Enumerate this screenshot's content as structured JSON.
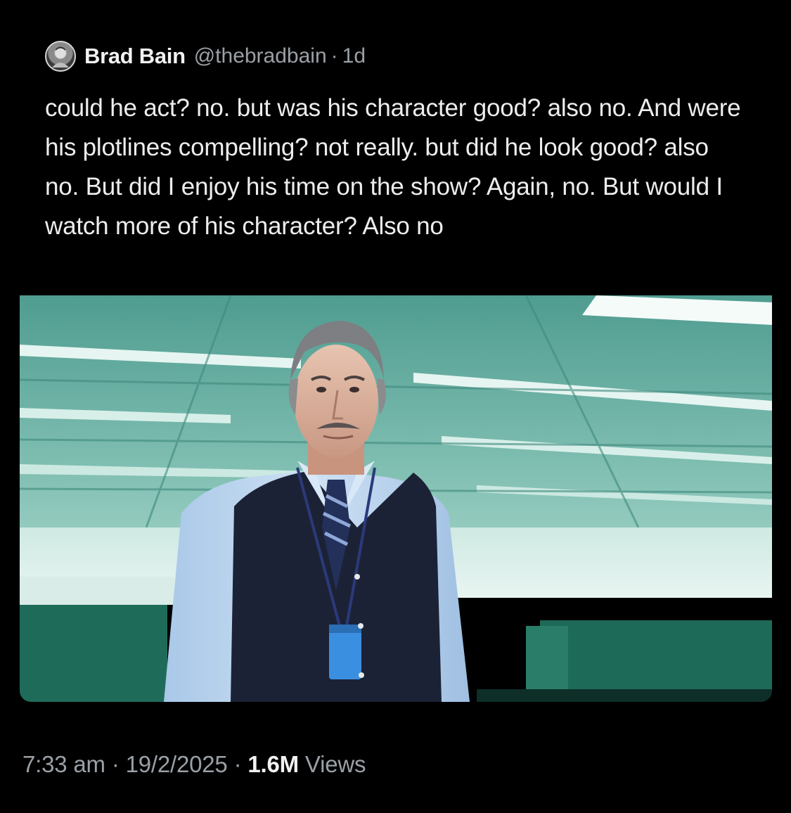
{
  "tweet": {
    "author_name": "Brad Bain",
    "author_handle": "@thebradbain",
    "separator": "·",
    "age": "1d",
    "text": "could he act? no. but was his character good? also no. And were his plotlines compelling? not really. but did he look good? also no. But did I enjoy his time on the show? Again, no. But would I watch more of his character? Also no",
    "media_description": "photo",
    "footer": {
      "time": "7:33 am",
      "date": "19/2/2025",
      "views_count": "1.6M",
      "views_label": "Views"
    }
  },
  "icons": {
    "avatar": "profile-photo-icon"
  },
  "colors": {
    "background": "#000000",
    "text_primary": "#e7e9ea",
    "text_secondary": "#9aa0a6",
    "image_ceiling": "#5fa89a",
    "image_partition": "#1f6b5a"
  }
}
